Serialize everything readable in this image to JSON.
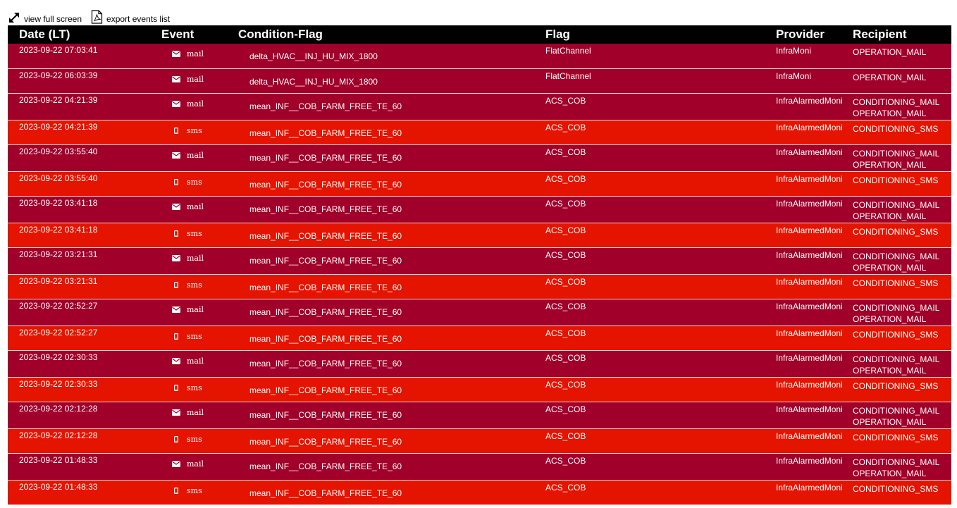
{
  "toolbar": {
    "fullscreen_label": "view full screen",
    "export_label": "export events list"
  },
  "columns": {
    "date": "Date (LT)",
    "event": "Event",
    "condition": "Condition-Flag",
    "flag": "Flag",
    "provider": "Provider",
    "recipient": "Recipient"
  },
  "colors": {
    "header_bg": "#000000",
    "mail_row": "#a0002a",
    "sms_row": "#e41400"
  },
  "rows": [
    {
      "date": "2023-09-22 07:03:41",
      "event": "mail",
      "icon": "envelope-icon",
      "condition": "delta_HVAC__INJ_HU_MIX_1800",
      "flag": "FlatChannel",
      "provider": "InfraMoni",
      "recipients": [
        "OPERATION_MAIL"
      ]
    },
    {
      "date": "2023-09-22 06:03:39",
      "event": "mail",
      "icon": "envelope-icon",
      "condition": "delta_HVAC__INJ_HU_MIX_1800",
      "flag": "FlatChannel",
      "provider": "InfraMoni",
      "recipients": [
        "OPERATION_MAIL"
      ]
    },
    {
      "date": "2023-09-22 04:21:39",
      "event": "mail",
      "icon": "envelope-icon",
      "condition": "mean_INF__COB_FARM_FREE_TE_60",
      "flag": "ACS_COB",
      "provider": "InfraAlarmedMoni",
      "recipients": [
        "CONDITIONING_MAIL",
        "OPERATION_MAIL"
      ]
    },
    {
      "date": "2023-09-22 04:21:39",
      "event": "sms",
      "icon": "mobile-phone-icon",
      "condition": "mean_INF__COB_FARM_FREE_TE_60",
      "flag": "ACS_COB",
      "provider": "InfraAlarmedMoni",
      "recipients": [
        "CONDITIONING_SMS"
      ]
    },
    {
      "date": "2023-09-22 03:55:40",
      "event": "mail",
      "icon": "envelope-icon",
      "condition": "mean_INF__COB_FARM_FREE_TE_60",
      "flag": "ACS_COB",
      "provider": "InfraAlarmedMoni",
      "recipients": [
        "CONDITIONING_MAIL",
        "OPERATION_MAIL"
      ]
    },
    {
      "date": "2023-09-22 03:55:40",
      "event": "sms",
      "icon": "mobile-phone-icon",
      "condition": "mean_INF__COB_FARM_FREE_TE_60",
      "flag": "ACS_COB",
      "provider": "InfraAlarmedMoni",
      "recipients": [
        "CONDITIONING_SMS"
      ]
    },
    {
      "date": "2023-09-22 03:41:18",
      "event": "mail",
      "icon": "envelope-icon",
      "condition": "mean_INF__COB_FARM_FREE_TE_60",
      "flag": "ACS_COB",
      "provider": "InfraAlarmedMoni",
      "recipients": [
        "CONDITIONING_MAIL",
        "OPERATION_MAIL"
      ]
    },
    {
      "date": "2023-09-22 03:41:18",
      "event": "sms",
      "icon": "mobile-phone-icon",
      "condition": "mean_INF__COB_FARM_FREE_TE_60",
      "flag": "ACS_COB",
      "provider": "InfraAlarmedMoni",
      "recipients": [
        "CONDITIONING_SMS"
      ]
    },
    {
      "date": "2023-09-22 03:21:31",
      "event": "mail",
      "icon": "envelope-icon",
      "condition": "mean_INF__COB_FARM_FREE_TE_60",
      "flag": "ACS_COB",
      "provider": "InfraAlarmedMoni",
      "recipients": [
        "CONDITIONING_MAIL",
        "OPERATION_MAIL"
      ]
    },
    {
      "date": "2023-09-22 03:21:31",
      "event": "sms",
      "icon": "mobile-phone-icon",
      "condition": "mean_INF__COB_FARM_FREE_TE_60",
      "flag": "ACS_COB",
      "provider": "InfraAlarmedMoni",
      "recipients": [
        "CONDITIONING_SMS"
      ]
    },
    {
      "date": "2023-09-22 02:52:27",
      "event": "mail",
      "icon": "envelope-icon",
      "condition": "mean_INF__COB_FARM_FREE_TE_60",
      "flag": "ACS_COB",
      "provider": "InfraAlarmedMoni",
      "recipients": [
        "CONDITIONING_MAIL",
        "OPERATION_MAIL"
      ]
    },
    {
      "date": "2023-09-22 02:52:27",
      "event": "sms",
      "icon": "mobile-phone-icon",
      "condition": "mean_INF__COB_FARM_FREE_TE_60",
      "flag": "ACS_COB",
      "provider": "InfraAlarmedMoni",
      "recipients": [
        "CONDITIONING_SMS"
      ]
    },
    {
      "date": "2023-09-22 02:30:33",
      "event": "mail",
      "icon": "envelope-icon",
      "condition": "mean_INF__COB_FARM_FREE_TE_60",
      "flag": "ACS_COB",
      "provider": "InfraAlarmedMoni",
      "recipients": [
        "CONDITIONING_MAIL",
        "OPERATION_MAIL"
      ]
    },
    {
      "date": "2023-09-22 02:30:33",
      "event": "sms",
      "icon": "mobile-phone-icon",
      "condition": "mean_INF__COB_FARM_FREE_TE_60",
      "flag": "ACS_COB",
      "provider": "InfraAlarmedMoni",
      "recipients": [
        "CONDITIONING_SMS"
      ]
    },
    {
      "date": "2023-09-22 02:12:28",
      "event": "mail",
      "icon": "envelope-icon",
      "condition": "mean_INF__COB_FARM_FREE_TE_60",
      "flag": "ACS_COB",
      "provider": "InfraAlarmedMoni",
      "recipients": [
        "CONDITIONING_MAIL",
        "OPERATION_MAIL"
      ]
    },
    {
      "date": "2023-09-22 02:12:28",
      "event": "sms",
      "icon": "mobile-phone-icon",
      "condition": "mean_INF__COB_FARM_FREE_TE_60",
      "flag": "ACS_COB",
      "provider": "InfraAlarmedMoni",
      "recipients": [
        "CONDITIONING_SMS"
      ]
    },
    {
      "date": "2023-09-22 01:48:33",
      "event": "mail",
      "icon": "envelope-icon",
      "condition": "mean_INF__COB_FARM_FREE_TE_60",
      "flag": "ACS_COB",
      "provider": "InfraAlarmedMoni",
      "recipients": [
        "CONDITIONING_MAIL",
        "OPERATION_MAIL"
      ]
    },
    {
      "date": "2023-09-22 01:48:33",
      "event": "sms",
      "icon": "mobile-phone-icon",
      "condition": "mean_INF__COB_FARM_FREE_TE_60",
      "flag": "ACS_COB",
      "provider": "InfraAlarmedMoni",
      "recipients": [
        "CONDITIONING_SMS"
      ]
    }
  ]
}
